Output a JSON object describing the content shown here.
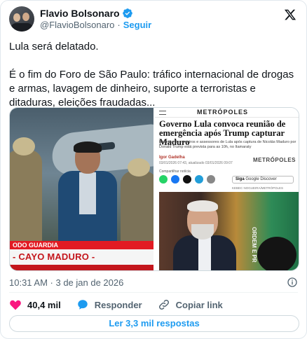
{
  "author": {
    "display_name": "Flavio Bolsonaro",
    "handle": "@FlavioBolsonaro",
    "separator": "·",
    "follow_label": "Seguir"
  },
  "tweet": {
    "line1": "Lula será delatado.",
    "line2": " É o fim do Foro de São Paulo: tráfico internacional de drogas e armas, lavagem de dinheiro, suporte a terroristas e ditaduras, eleições fraudadas..."
  },
  "media": {
    "left": {
      "banner_top": "ODO GUARDIA",
      "banner_main": "- CAYO MADURO - CAPTURADO!"
    },
    "right": {
      "site_logo": "METRÓPOLES",
      "headline": "Governo Lula convoca reunião de emergência após Trump capturar Maduro",
      "subtitle": "Reunião de ministros e assessores de Lula após captura de Nicolás Maduro por Donald Trump está prevista para as 10h, no Itamaraty",
      "author": "Igor Gadelha",
      "dates": "03/01/2026 07:43, atualizado 03/01/2026 09:07",
      "pub_logo": "METRÓPOLES",
      "share_label": "Compartilhar notícia",
      "siga_label": "Siga",
      "siga_service": "Google Discover",
      "credit": "KEBEC NOGUEIRA/METRÓPOLES",
      "flag_text": "ORDEM E PR"
    }
  },
  "meta": {
    "timestamp": "10:31 AM · 3 de jan de 2026"
  },
  "actions": {
    "likes": "40,4 mil",
    "reply_label": "Responder",
    "copy_label": "Copiar link"
  },
  "replies_button": "Ler 3,3 mil respostas",
  "colors": {
    "accent": "#1d9bf0",
    "like": "#f91880",
    "secondary_text": "#536471"
  }
}
